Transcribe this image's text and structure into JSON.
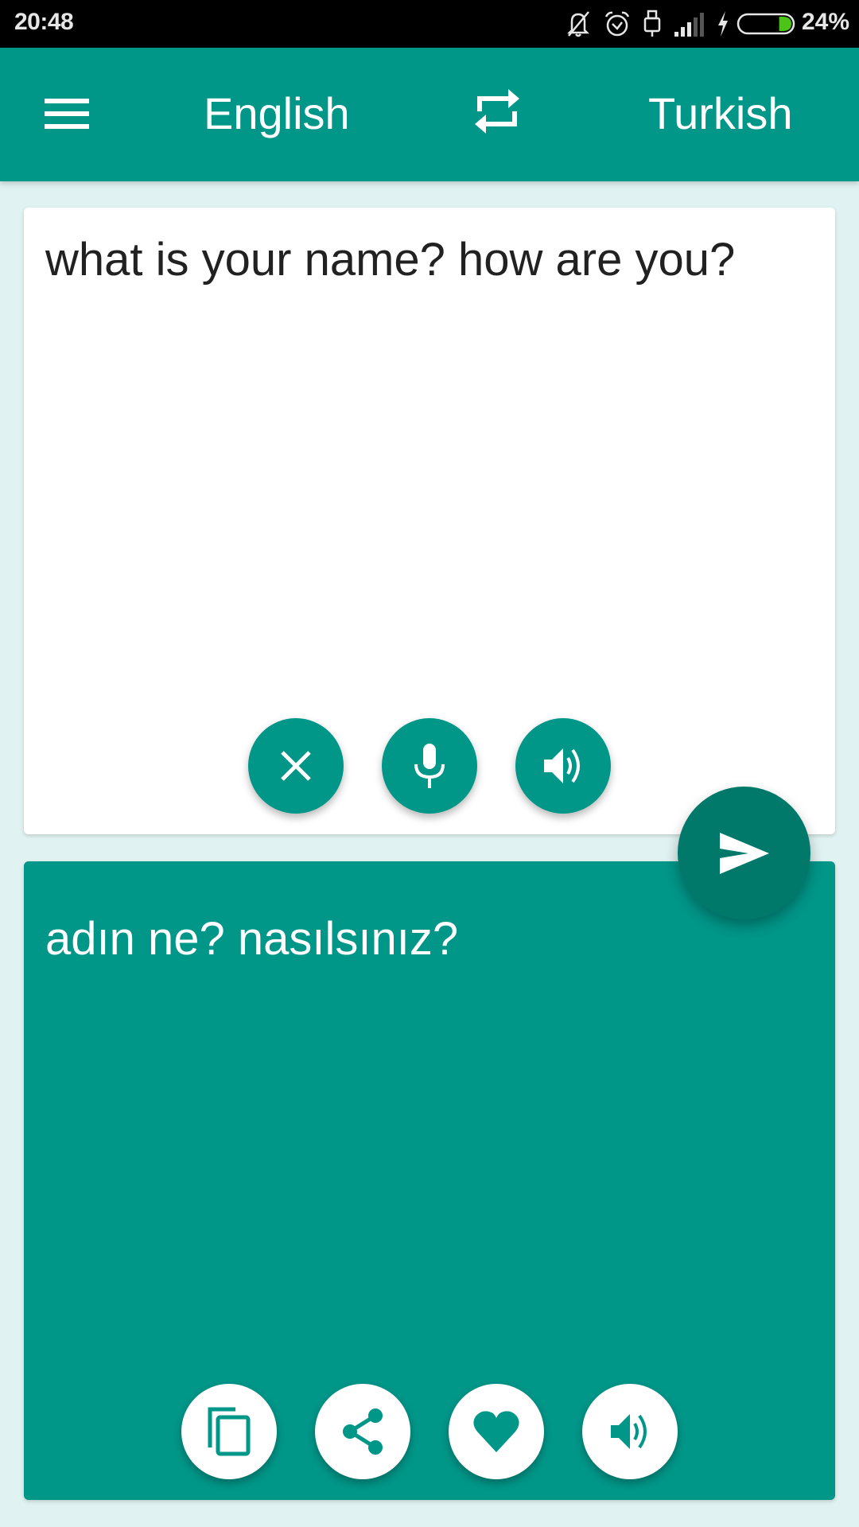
{
  "status_bar": {
    "time": "20:48",
    "icons": [
      "notifications-muted-icon",
      "alarm-icon",
      "usb-icon",
      "signal-icon",
      "charging-bolt-icon",
      "battery-icon"
    ],
    "battery_percent_label": "24%",
    "battery_level": 0.24,
    "battery_fill_color": "#4CC417"
  },
  "app_bar": {
    "menu_icon": "hamburger-menu-icon",
    "source_language": "English",
    "swap_icon": "swap-languages-icon",
    "target_language": "Turkish",
    "color": "#009688"
  },
  "input_card": {
    "text": "what is your name? how are you?",
    "buttons": [
      {
        "name": "clear-button",
        "icon": "close-icon"
      },
      {
        "name": "voice-input-button",
        "icon": "microphone-icon"
      },
      {
        "name": "speak-source-button",
        "icon": "speaker-icon"
      }
    ]
  },
  "translate_button": {
    "icon": "send-icon",
    "color": "#00796B"
  },
  "output_card": {
    "text": "adın ne? nasılsınız?",
    "color": "#009688",
    "buttons": [
      {
        "name": "copy-button",
        "icon": "copy-icon"
      },
      {
        "name": "share-button",
        "icon": "share-icon"
      },
      {
        "name": "favorite-button",
        "icon": "heart-icon"
      },
      {
        "name": "speak-translation-button",
        "icon": "speaker-icon"
      }
    ]
  },
  "colors": {
    "background": "#E0F2F1",
    "primary": "#009688",
    "primary_dark": "#00796B"
  }
}
